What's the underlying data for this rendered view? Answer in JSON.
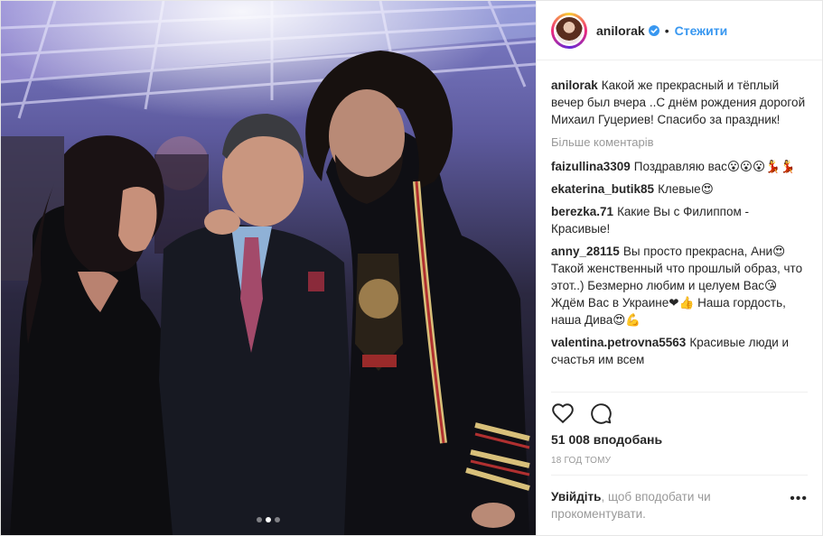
{
  "post": {
    "username": "anilorak",
    "follow_label": "Стежити",
    "separator": "•",
    "caption": "Какой же прекрасный и тёплый вечер был вчера ..С днём рождения дорогой Михаил Гуцериев! Спасибо за праздник!",
    "more_comments": "Більше коментарів",
    "comments": [
      {
        "user": "faizullina3309",
        "text": "Поздравляю вас😮😮😮💃💃"
      },
      {
        "user": "ekaterina_butik85",
        "text": "Клевые😍"
      },
      {
        "user": "berezka.71",
        "text": "Какие Вы с Филиппом - Красивые!"
      },
      {
        "user": "anny_28115",
        "text": "Вы просто прекрасна, Ани😍 Такой женственный что прошлый образ, что этот..) Безмерно любим и целуем Вас😘 Ждём Вас в Украине❤👍 Наша гордость, наша Дива😍💪"
      },
      {
        "user": "valentina.petrovna5563",
        "text": "Красивые люди и счастья им всем"
      }
    ],
    "likes": "51 008 вподобань",
    "timestamp": "18 ГОД ТОМУ",
    "login_link": "Увійдіть",
    "login_text": ", щоб вподобати чи прокоментувати.",
    "more_options": "•••",
    "carousel": {
      "count": 3,
      "active_index": 1
    }
  },
  "colors": {
    "link_blue": "#3897f0",
    "text": "#262626",
    "muted": "#999999",
    "verified": "#3897f0"
  },
  "icons": {
    "like": "heart-icon",
    "comment": "comment-icon",
    "verified": "verified-badge-icon",
    "options": "more-options-icon"
  }
}
